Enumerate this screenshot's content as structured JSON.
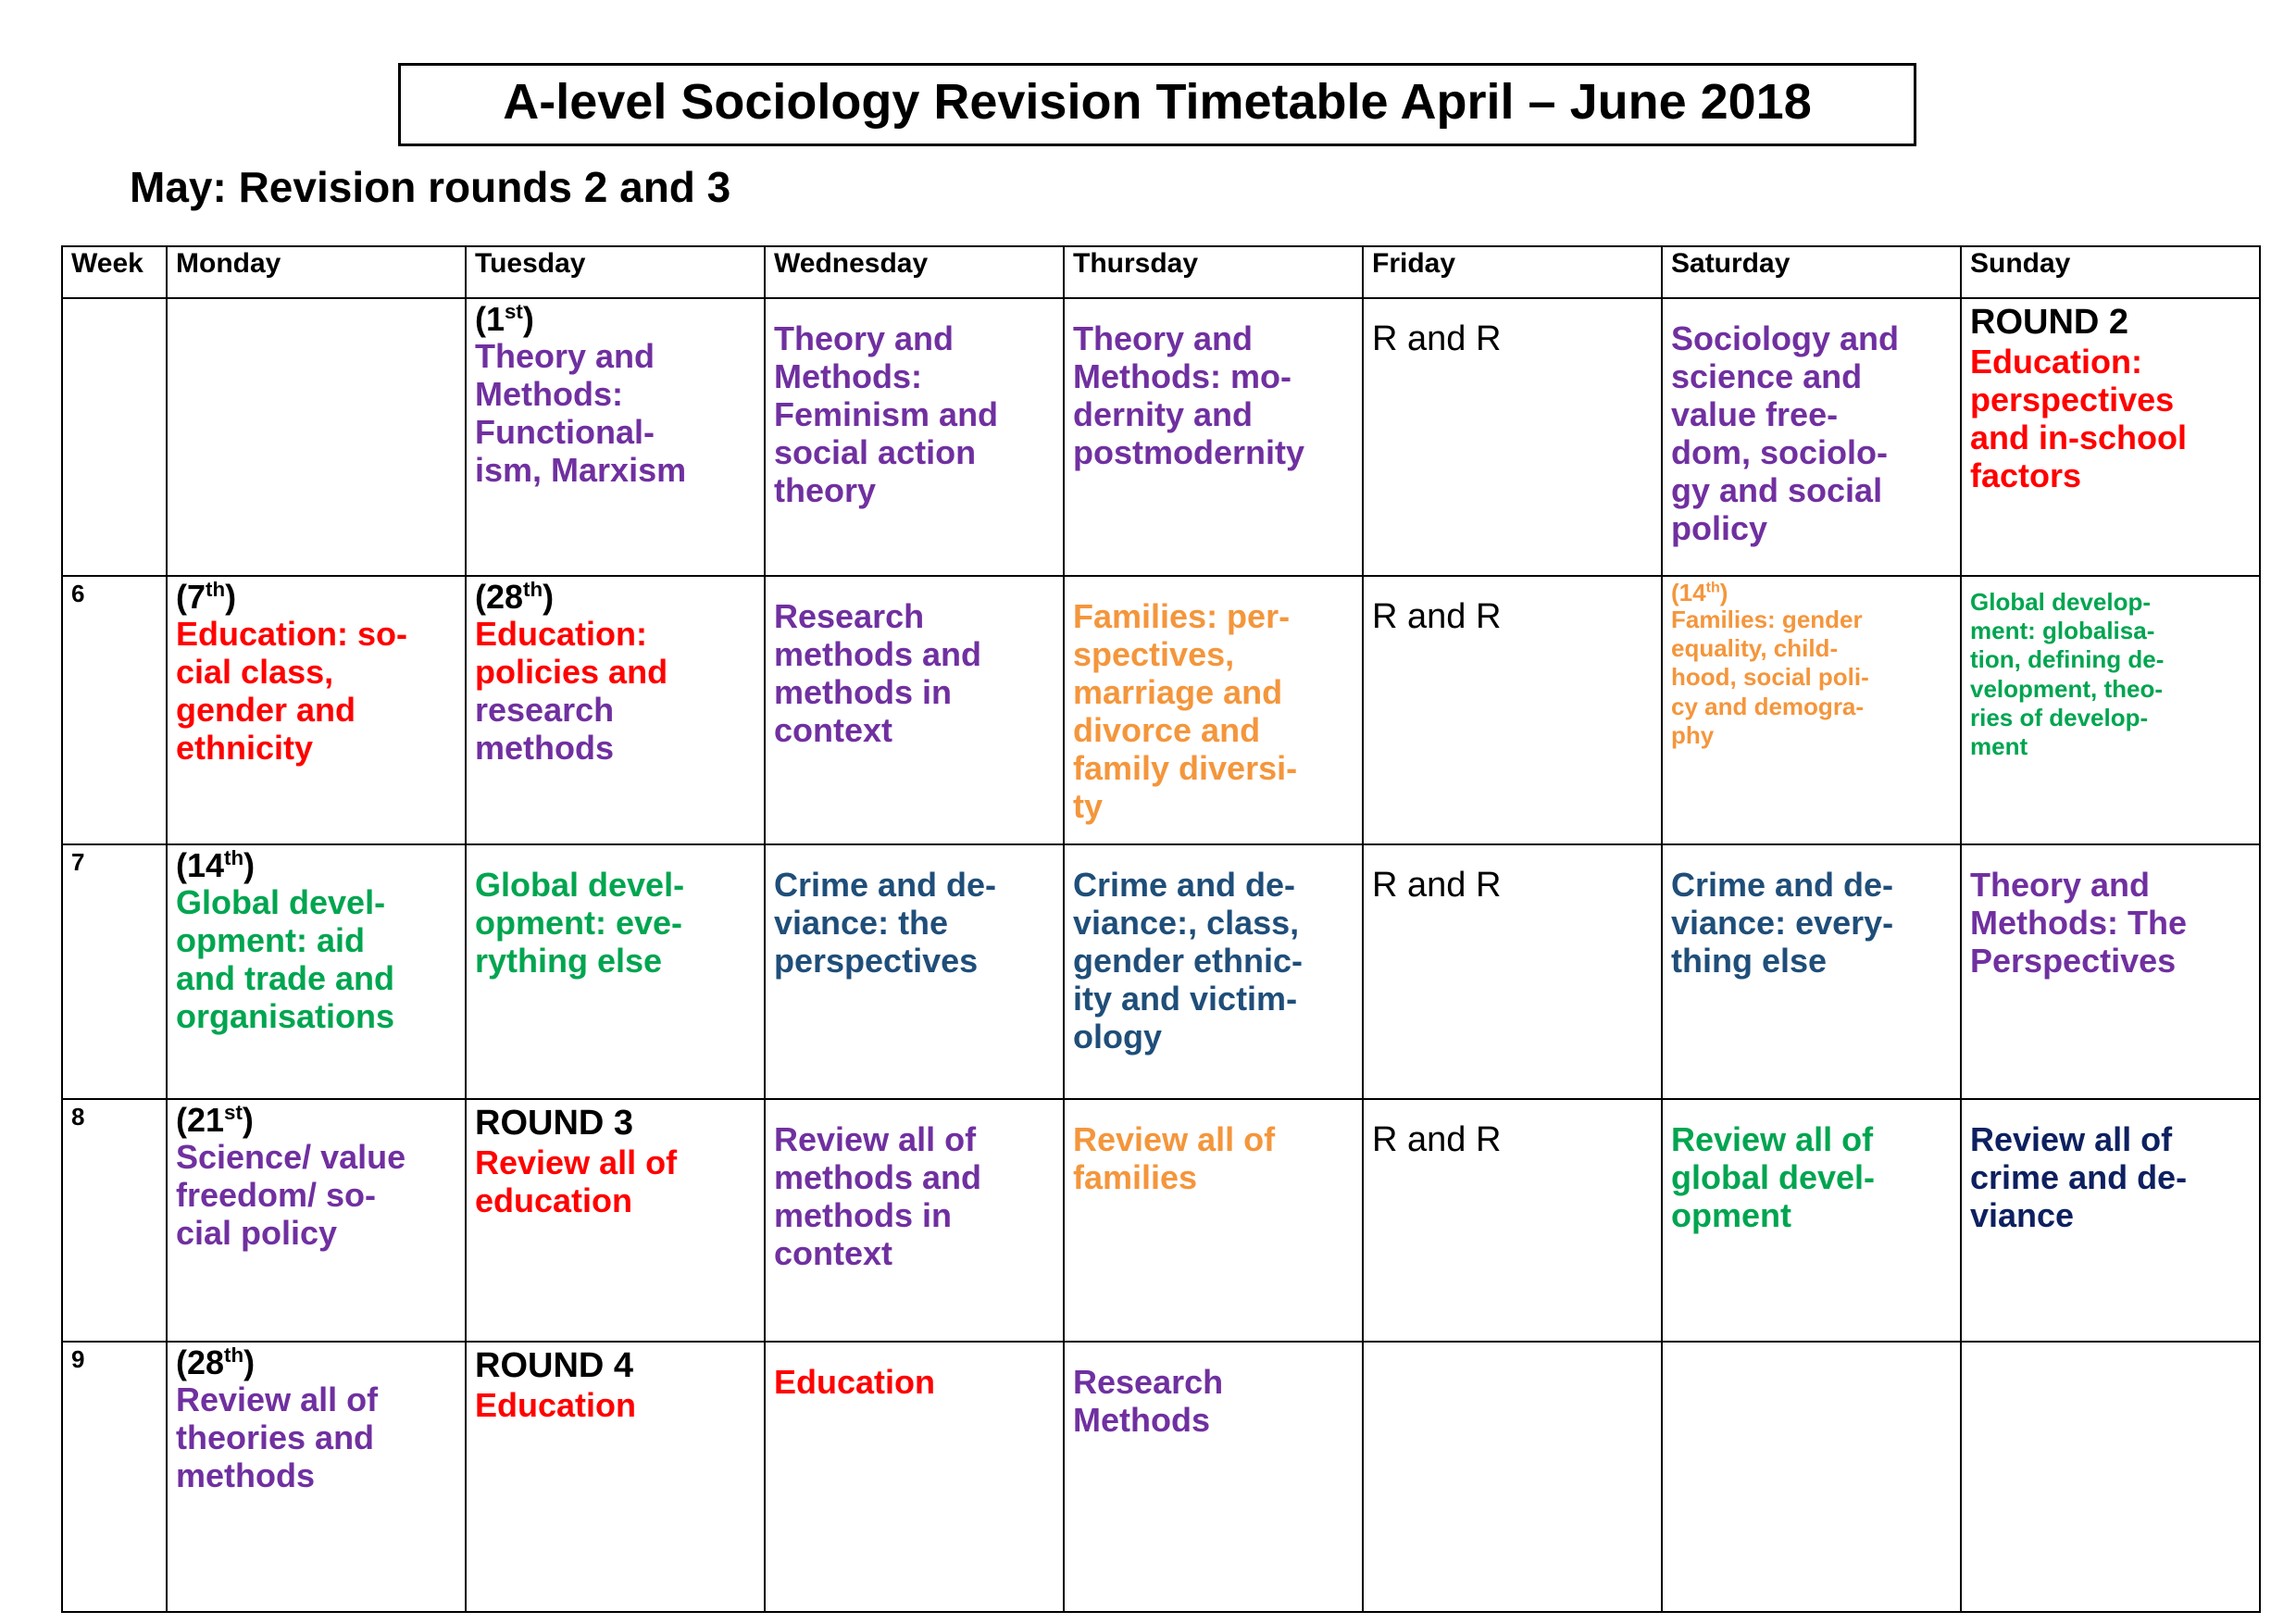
{
  "document": {
    "title": "A-level Sociology Revision Timetable April – June 2018",
    "subtitle": "May: Revision rounds 2 and 3"
  },
  "colors": {
    "purple": "#7030A0",
    "red": "#FF0000",
    "orange": "#F4963C",
    "green": "#00A550",
    "blue": "#1F4E79",
    "navy": "#0D2060",
    "black": "#000000",
    "friday_shade": "#D9D9D9"
  },
  "table": {
    "headers": {
      "week": "Week",
      "monday": "Monday",
      "tuesday": "Tuesday",
      "wednesday": "Wednesday",
      "thursday": "Thursday",
      "friday": "Friday",
      "saturday": "Saturday",
      "sunday": "Sunday"
    },
    "rows": [
      {
        "week": "",
        "monday": {
          "date": "",
          "lines": []
        },
        "tuesday": {
          "date_pre": "(1",
          "date_sup": "st",
          "date_post": ")",
          "lines": [
            {
              "text": "Theory and",
              "color": "purple"
            },
            {
              "text": "Methods:",
              "color": "purple"
            },
            {
              "text": "Functional-",
              "color": "purple"
            },
            {
              "text": "ism, Marxism",
              "color": "purple"
            }
          ]
        },
        "wednesday": {
          "lines": [
            {
              "text": "Theory and",
              "color": "purple"
            },
            {
              "text": "Methods:",
              "color": "purple"
            },
            {
              "text": "Feminism and",
              "color": "purple"
            },
            {
              "text": "social action",
              "color": "purple"
            },
            {
              "text": "theory",
              "color": "purple"
            }
          ]
        },
        "thursday": {
          "lines": [
            {
              "text": "Theory and",
              "color": "purple"
            },
            {
              "text": "Methods: mo-",
              "color": "purple"
            },
            {
              "text": "dernity and",
              "color": "purple"
            },
            {
              "text": "postmodernity",
              "color": "purple"
            }
          ]
        },
        "friday": {
          "lines": [
            {
              "text": "R and R",
              "color": "black",
              "plain": true
            }
          ]
        },
        "saturday": {
          "lines": [
            {
              "text": "Sociology and",
              "color": "purple"
            },
            {
              "text": "science and",
              "color": "purple"
            },
            {
              "text": "value free-",
              "color": "purple"
            },
            {
              "text": "dom, sociolo-",
              "color": "purple"
            },
            {
              "text": "gy and social",
              "color": "purple"
            },
            {
              "text": "policy",
              "color": "purple"
            }
          ]
        },
        "sunday": {
          "lines": [
            {
              "text": "ROUND 2",
              "color": "black",
              "round": true
            },
            {
              "text": "Education:",
              "color": "red"
            },
            {
              "text": "perspectives",
              "color": "red"
            },
            {
              "text": "and in-school",
              "color": "red"
            },
            {
              "text": "factors",
              "color": "red"
            }
          ]
        }
      },
      {
        "week": "6",
        "monday": {
          "date_pre": "(7",
          "date_sup": "th",
          "date_post": ")",
          "lines": [
            {
              "text": "Education: so-",
              "color": "red"
            },
            {
              "text": "cial class,",
              "color": "red"
            },
            {
              "text": "gender and",
              "color": "red"
            },
            {
              "text": "ethnicity",
              "color": "red"
            }
          ]
        },
        "tuesday": {
          "date_pre": "(28",
          "date_sup": "th",
          "date_post": ")",
          "lines": [
            {
              "text": "Education:",
              "color": "red"
            },
            {
              "text": "policies and",
              "color": "red"
            },
            {
              "text": "research",
              "color": "purple"
            },
            {
              "text": "methods",
              "color": "purple"
            }
          ]
        },
        "wednesday": {
          "lines": [
            {
              "text": "Research",
              "color": "purple"
            },
            {
              "text": "methods and",
              "color": "purple"
            },
            {
              "text": "methods in",
              "color": "purple"
            },
            {
              "text": "context",
              "color": "purple"
            }
          ]
        },
        "thursday": {
          "lines": [
            {
              "text": "Families: per-",
              "color": "orange"
            },
            {
              "text": "spectives,",
              "color": "orange"
            },
            {
              "text": "marriage and",
              "color": "orange"
            },
            {
              "text": "divorce and",
              "color": "orange"
            },
            {
              "text": "family diversi-",
              "color": "orange"
            },
            {
              "text": "ty",
              "color": "orange"
            }
          ]
        },
        "friday": {
          "lines": [
            {
              "text": "R and R",
              "color": "black",
              "plain": true
            }
          ]
        },
        "saturday": {
          "date_pre": "(14",
          "date_sup": "th",
          "date_post": ")",
          "date_color": "orange",
          "small": true,
          "lines": [
            {
              "text": "Families: gender",
              "color": "orange"
            },
            {
              "text": "equality, child-",
              "color": "orange"
            },
            {
              "text": "hood, social poli-",
              "color": "orange"
            },
            {
              "text": "cy and demogra-",
              "color": "orange"
            },
            {
              "text": "phy",
              "color": "orange"
            }
          ]
        },
        "sunday": {
          "small": true,
          "lines": [
            {
              "text": "Global develop-",
              "color": "green"
            },
            {
              "text": "ment: globalisa-",
              "color": "green"
            },
            {
              "text": "tion, defining de-",
              "color": "green"
            },
            {
              "text": "velopment, theo-",
              "color": "green"
            },
            {
              "text": "ries of develop-",
              "color": "green"
            },
            {
              "text": "ment",
              "color": "green"
            }
          ]
        }
      },
      {
        "week": "7",
        "monday": {
          "date_pre": "(14",
          "date_sup": "th",
          "date_post": ")",
          "lines": [
            {
              "text": "Global devel-",
              "color": "green"
            },
            {
              "text": "opment: aid",
              "color": "green"
            },
            {
              "text": "and trade and",
              "color": "green"
            },
            {
              "text": "organisations",
              "color": "green"
            }
          ]
        },
        "tuesday": {
          "lines": [
            {
              "text": "Global devel-",
              "color": "green"
            },
            {
              "text": "opment: eve-",
              "color": "green"
            },
            {
              "text": "rything else",
              "color": "green"
            }
          ]
        },
        "wednesday": {
          "lines": [
            {
              "text": "Crime and de-",
              "color": "blue"
            },
            {
              "text": "viance: the",
              "color": "blue"
            },
            {
              "text": "perspectives",
              "color": "blue"
            }
          ]
        },
        "thursday": {
          "lines": [
            {
              "text": "Crime and de-",
              "color": "blue"
            },
            {
              "text": "viance:, class,",
              "color": "blue"
            },
            {
              "text": "gender ethnic-",
              "color": "blue"
            },
            {
              "text": "ity and victim-",
              "color": "blue"
            },
            {
              "text": "ology",
              "color": "blue"
            }
          ]
        },
        "friday": {
          "lines": [
            {
              "text": "R and R",
              "color": "black",
              "plain": true
            }
          ]
        },
        "saturday": {
          "lines": [
            {
              "text": "Crime and de-",
              "color": "blue"
            },
            {
              "text": "viance: every-",
              "color": "blue"
            },
            {
              "text": "thing else",
              "color": "blue"
            }
          ]
        },
        "sunday": {
          "lines": [
            {
              "text": "Theory and",
              "color": "purple"
            },
            {
              "text": "Methods: The",
              "color": "purple"
            },
            {
              "text": "Perspectives",
              "color": "purple"
            }
          ]
        }
      },
      {
        "week": "8",
        "monday": {
          "date_pre": "(21",
          "date_sup": "st",
          "date_post": ")",
          "lines": [
            {
              "text": "Science/ value",
              "color": "purple"
            },
            {
              "text": "freedom/ so-",
              "color": "purple"
            },
            {
              "text": "cial policy",
              "color": "purple"
            }
          ]
        },
        "tuesday": {
          "lines": [
            {
              "text": "ROUND 3",
              "color": "black",
              "round": true
            },
            {
              "text": "Review all of",
              "color": "red"
            },
            {
              "text": "education",
              "color": "red"
            }
          ]
        },
        "wednesday": {
          "lines": [
            {
              "text": "Review all of",
              "color": "purple"
            },
            {
              "text": "methods and",
              "color": "purple"
            },
            {
              "text": "methods in",
              "color": "purple"
            },
            {
              "text": "context",
              "color": "purple"
            }
          ]
        },
        "thursday": {
          "lines": [
            {
              "text": "Review all of",
              "color": "orange"
            },
            {
              "text": "families",
              "color": "orange"
            }
          ]
        },
        "friday": {
          "lines": [
            {
              "text": "R and R",
              "color": "black",
              "plain": true
            }
          ]
        },
        "saturday": {
          "lines": [
            {
              "text": "Review all of",
              "color": "green"
            },
            {
              "text": "global devel-",
              "color": "green"
            },
            {
              "text": "opment",
              "color": "green"
            }
          ]
        },
        "sunday": {
          "lines": [
            {
              "text": "Review all of",
              "color": "navy"
            },
            {
              "text": "crime and de-",
              "color": "navy"
            },
            {
              "text": "viance",
              "color": "navy"
            }
          ]
        }
      },
      {
        "week": "9",
        "monday": {
          "date_pre": "(28",
          "date_sup": "th",
          "date_post": ")",
          "lines": [
            {
              "text": "Review all of",
              "color": "purple"
            },
            {
              "text": "theories and",
              "color": "purple"
            },
            {
              "text": "methods",
              "color": "purple"
            }
          ]
        },
        "tuesday": {
          "lines": [
            {
              "text": "ROUND 4",
              "color": "black",
              "round": true
            },
            {
              "text": "Education",
              "color": "red"
            }
          ]
        },
        "wednesday": {
          "lines": [
            {
              "text": "Education",
              "color": "red"
            }
          ]
        },
        "thursday": {
          "lines": [
            {
              "text": "Research",
              "color": "purple"
            },
            {
              "text": "Methods",
              "color": "purple"
            }
          ]
        },
        "friday": {
          "ghost": true,
          "lines": []
        },
        "saturday": {
          "ghost": true,
          "lines": []
        },
        "sunday": {
          "ghost": true,
          "lines": []
        }
      }
    ]
  }
}
